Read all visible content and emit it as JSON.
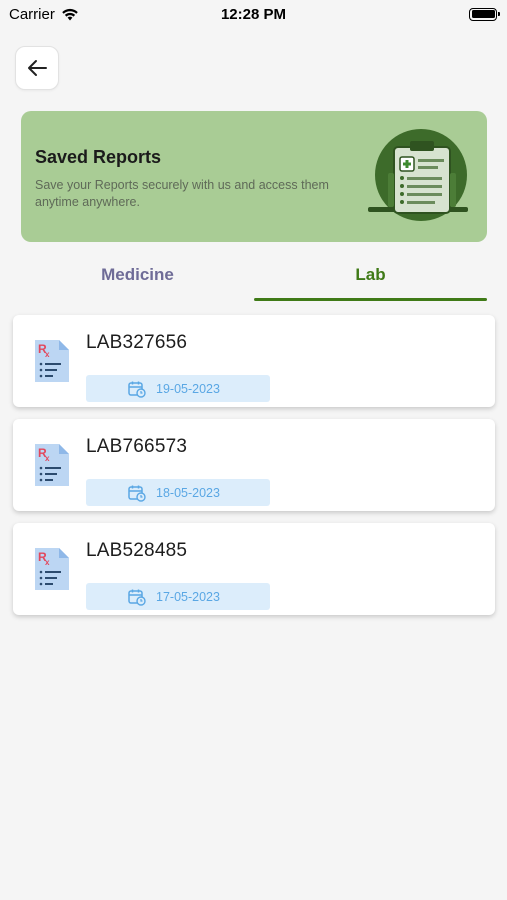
{
  "status_bar": {
    "carrier": "Carrier",
    "time": "12:28 PM"
  },
  "header": {
    "back_icon": "arrow-left-icon"
  },
  "banner": {
    "title": "Saved Reports",
    "description": "Save your Reports securely with us and access them anytime anywhere.",
    "illustration": "clipboard-report-icon",
    "color": "#a9cc95"
  },
  "tabs": [
    {
      "label": "Medicine",
      "active": false
    },
    {
      "label": "Lab",
      "active": true
    }
  ],
  "reports": [
    {
      "id": "LAB327656",
      "date": "19-05-2023",
      "icon": "prescription-document-icon"
    },
    {
      "id": "LAB766573",
      "date": "18-05-2023",
      "icon": "prescription-document-icon"
    },
    {
      "id": "LAB528485",
      "date": "17-05-2023",
      "icon": "prescription-document-icon"
    }
  ],
  "colors": {
    "accent": "#3f7a17",
    "tab_inactive": "#6f6c97",
    "date_chip_bg": "#dcedfb",
    "date_chip_text": "#5aa7e4"
  }
}
